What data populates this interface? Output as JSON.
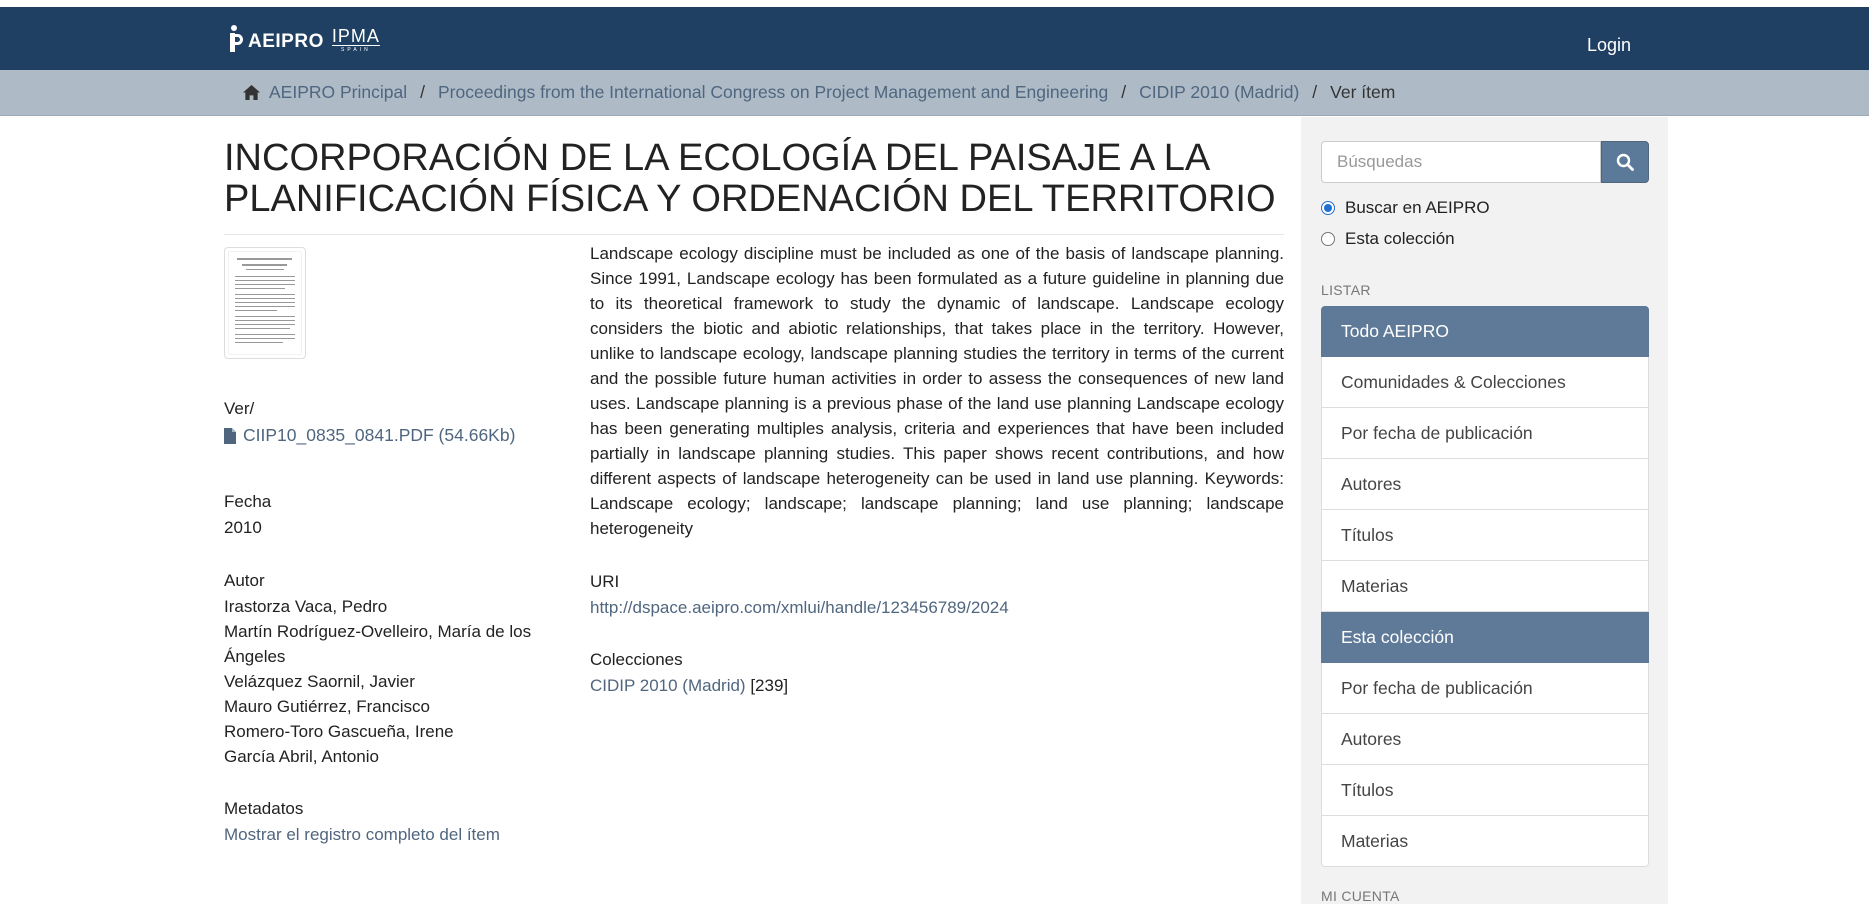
{
  "header": {
    "brand_aeipro": "AEIPRO",
    "brand_ipma": "IPMA",
    "brand_ipma_sub": "SPAIN",
    "login": "Login"
  },
  "breadcrumb": {
    "items": [
      "AEIPRO Principal",
      "Proceedings from the International Congress on Project Management and Engineering",
      "CIDIP 2010 (Madrid)"
    ],
    "current": "Ver ítem",
    "separator": "/"
  },
  "item": {
    "title": "INCORPORACIÓN DE LA ECOLOGÍA DEL PAISAJE A LA PLANIFICACIÓN FÍSICA Y ORDENACIÓN DEL TERRITORIO",
    "view_label": "Ver/",
    "file_name": "CIIP10_0835_0841.PDF (54.66Kb)",
    "date_label": "Fecha",
    "date_value": "2010",
    "author_label": "Autor",
    "authors": [
      "Irastorza Vaca, Pedro",
      "Martín Rodríguez-Ovelleiro, María de los Ángeles",
      "Velázquez Saornil, Javier",
      "Mauro Gutiérrez, Francisco",
      "Romero-Toro Gascueña, Irene",
      "García Abril, Antonio"
    ],
    "metadata_label": "Metadatos",
    "metadata_link": "Mostrar el registro completo del ítem",
    "abstract": "Landscape ecology discipline must be included as one of the basis of landscape planning. Since 1991, Landscape ecology has been formulated as a future guideline in planning due to its theoretical framework to study the dynamic of landscape. Landscape ecology considers the biotic and abiotic relationships, that takes place in the territory. However, unlike to landscape ecology, landscape planning studies the territory in terms of the current and the possible future human activities in order to assess the consequences of new land uses. Landscape planning is a previous phase of the land use planning Landscape ecology has been generating multiples analysis, criteria and experiences that have been included partially in landscape planning studies. This paper shows recent contributions, and how different aspects of landscape heterogeneity can be used in land use planning. Keywords: Landscape ecology; landscape; landscape planning; land use planning; landscape heterogeneity",
    "uri_label": "URI",
    "uri_value": "http://dspace.aeipro.com/xmlui/handle/123456789/2024",
    "collections_label": "Colecciones",
    "collection_link": "CIDIP 2010 (Madrid)",
    "collection_count": "[239]"
  },
  "sidebar": {
    "search_placeholder": "Búsquedas",
    "radio_all": "Buscar en AEIPRO",
    "radio_collection": "Esta colección",
    "browse_heading": "LISTAR",
    "group1": [
      "Todo AEIPRO",
      "Comunidades & Colecciones",
      "Por fecha de publicación",
      "Autores",
      "Títulos",
      "Materias"
    ],
    "group2": [
      "Esta colección",
      "Por fecha de publicación",
      "Autores",
      "Títulos",
      "Materias"
    ],
    "account_heading": "MI CUENTA"
  },
  "colors": {
    "navbar": "#1f4062",
    "breadcrumb_bar": "#aebbc7",
    "link": "#50667f",
    "active_list": "#5f7a98"
  }
}
